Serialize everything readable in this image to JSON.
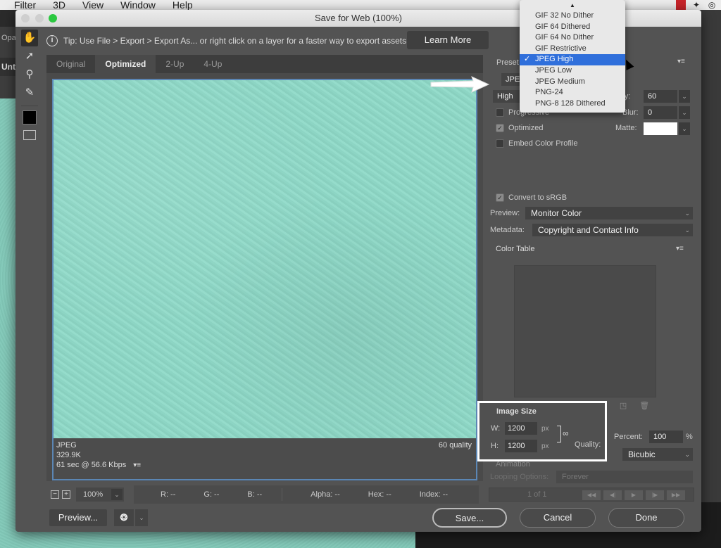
{
  "menubar": {
    "items": [
      "Filter",
      "3D",
      "View",
      "Window",
      "Help"
    ]
  },
  "background_app": {
    "panel_label_1": "Opa",
    "panel_label_2": "Untit"
  },
  "dialog": {
    "title": "Save for Web (100%)",
    "tip": {
      "text": "Tip: Use File > Export > Export As...  or right click on a layer for a faster way to export assets",
      "learn_more": "Learn More"
    },
    "tools": [
      "hand-tool",
      "slice-select-tool",
      "zoom-tool",
      "eyedropper-tool",
      "eyedropper-color",
      "toggle-slices-visibility"
    ],
    "tabs": [
      {
        "label": "Original",
        "active": false
      },
      {
        "label": "Optimized",
        "active": true
      },
      {
        "label": "2-Up",
        "active": false
      },
      {
        "label": "4-Up",
        "active": false
      }
    ],
    "preview_info": {
      "format": "JPEG",
      "size": "329.9K",
      "download": "61 sec @ 56.6 Kbps",
      "quality": "60 quality"
    },
    "statusbar": {
      "zoom": "100%",
      "r": "R: --",
      "g": "G: --",
      "b": "B: --",
      "alpha": "Alpha: --",
      "hex": "Hex: --",
      "index": "Index: --"
    },
    "buttons": {
      "preview": "Preview...",
      "save": "Save...",
      "cancel": "Cancel",
      "done": "Done"
    },
    "settings": {
      "preset_label": "Preset",
      "format_value": "JPEG",
      "compression_value": "High",
      "quality_label": "Quality:",
      "quality_value": "60",
      "progressive_label": "Progressive",
      "progressive_checked": false,
      "blur_label": "Blur:",
      "blur_value": "0",
      "optimized_label": "Optimized",
      "optimized_checked": true,
      "matte_label": "Matte:",
      "matte_color": "#ffffff",
      "embed_profile_label": "Embed Color Profile",
      "embed_profile_checked": false,
      "convert_srgb_label": "Convert to sRGB",
      "convert_srgb_checked": true,
      "preview_label": "Preview:",
      "preview_value": "Monitor Color",
      "metadata_label": "Metadata:",
      "metadata_value": "Copyright and Contact Info",
      "color_table_label": "Color Table"
    },
    "image_size": {
      "title": "Image Size",
      "w_label": "W:",
      "w_value": "1200",
      "h_label": "H:",
      "h_value": "1200",
      "unit": "px",
      "percent_label": "Percent:",
      "percent_value": "100",
      "percent_unit": "%",
      "quality_label": "Quality:",
      "quality_value": "Bicubic"
    },
    "animation": {
      "title": "Animation",
      "looping_label": "Looping Options:",
      "looping_value": "Forever",
      "frame_count": "1 of 1"
    }
  },
  "preset_dropdown": {
    "options": [
      {
        "label": "GIF 32 No Dither",
        "selected": false
      },
      {
        "label": "GIF 64 Dithered",
        "selected": false
      },
      {
        "label": "GIF 64 No Dither",
        "selected": false
      },
      {
        "label": "GIF Restrictive",
        "selected": false
      },
      {
        "label": "JPEG High",
        "selected": true
      },
      {
        "label": "JPEG Low",
        "selected": false
      },
      {
        "label": "JPEG Medium",
        "selected": false
      },
      {
        "label": "PNG-24",
        "selected": false
      },
      {
        "label": "PNG-8 128 Dithered",
        "selected": false
      }
    ]
  },
  "colors": {
    "selection_blue": "#2f6fdb",
    "preview_border": "#5b86b4",
    "image_teal": "#8dd5c4"
  }
}
